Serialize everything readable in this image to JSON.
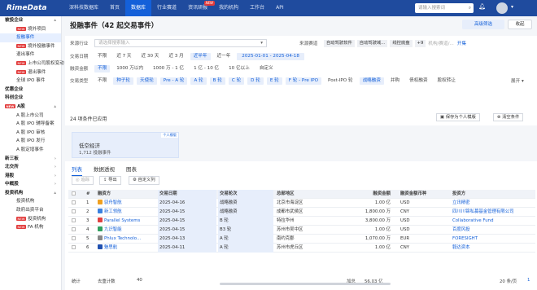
{
  "app": {
    "logo": "RimeData"
  },
  "nav": [
    "深科技数据库",
    "首页",
    "数据库",
    "行业赛道",
    "资讯研报",
    "我的机构",
    "工作台",
    "API"
  ],
  "nav_new_badge": "NEW",
  "search_placeholder": "请输入搜索词",
  "sidebar": {
    "items": [
      {
        "label": "被投企业",
        "type": "group"
      },
      {
        "label": "境外项目",
        "type": "sub",
        "tag": "NEW"
      },
      {
        "label": "投融事件",
        "type": "sub",
        "active": true
      },
      {
        "label": "境外投融事件",
        "type": "sub",
        "tag": "NEW"
      },
      {
        "label": "退出事件",
        "type": "sub"
      },
      {
        "label": "上市公司股权变动",
        "type": "sub",
        "tag": "NEW"
      },
      {
        "label": "退出事件",
        "type": "sub",
        "tag": "NEW"
      },
      {
        "label": "全球 IPO 事件",
        "type": "sub"
      },
      {
        "label": "优惠企业",
        "type": "group"
      },
      {
        "label": "科创企业",
        "type": "group"
      },
      {
        "label": "A股",
        "type": "group",
        "tag": "NEW"
      },
      {
        "label": "A 股上市公司",
        "type": "sub"
      },
      {
        "label": "A 股 IPO 辅导备案",
        "type": "sub"
      },
      {
        "label": "A 股 IPO 审核",
        "type": "sub"
      },
      {
        "label": "A 股 IPO 发行",
        "type": "sub"
      },
      {
        "label": "A 股定增事件",
        "type": "sub"
      },
      {
        "label": "新三板",
        "type": "group"
      },
      {
        "label": "北交所",
        "type": "group"
      },
      {
        "label": "港股",
        "type": "group"
      },
      {
        "label": "中概股",
        "type": "group"
      },
      {
        "label": "投资机构",
        "type": "group"
      },
      {
        "label": "投资机构",
        "type": "sub"
      },
      {
        "label": "政府出资平台",
        "type": "sub"
      },
      {
        "label": "投资机构",
        "type": "sub",
        "tag": "NEW"
      },
      {
        "label": "FA 机构",
        "type": "sub",
        "tag": "NEW"
      }
    ]
  },
  "header": {
    "title": "投融事件（42 起交易事件）",
    "advanced_btn": "高级筛选",
    "collapse_btn": "收起"
  },
  "filters": {
    "company_label": "来源行业",
    "company_placeholder": "请选择搜索输入",
    "industry_label": "来源赛道",
    "industry_tags": [
      "自动驾驶软件",
      "自动驾驶域...",
      "线控底盘"
    ],
    "industry_more": "+9",
    "industry_extra": "机构/赛道/...",
    "industry_toggle": "开集",
    "date_label": "交易日期",
    "date_chips": [
      "不限",
      "近 7 天",
      "近 30 天",
      "近 3 月",
      "近半年",
      "近一年"
    ],
    "date_range": "2025-01-01 - 2025-04-18",
    "amount_label": "融资金额",
    "amount_chips": [
      "不限",
      "1000 万以内",
      "1000 万 - 1 亿",
      "1 亿 - 10 亿",
      "10 亿以上",
      "自定义"
    ],
    "type_label": "交易类型",
    "type_chips": [
      "不限",
      "种子轮",
      "天使轮",
      "Pre - A 轮",
      "A 轮",
      "B 轮",
      "C 轮",
      "D 轮",
      "E 轮",
      "F 轮 - Pre IPO",
      "Post-IPO 轮",
      "战略融资",
      "并购",
      "债权融资",
      "股权转让"
    ],
    "type_expand": "展开",
    "applied": "24 项条件已应用",
    "save_template": "保存为个人模版",
    "clear": "清空条件"
  },
  "card": {
    "tag": "个人模版",
    "name": "低空经济",
    "count": "1,712 投融事件"
  },
  "tabs": [
    "列表",
    "数据透视",
    "图表"
  ],
  "toolbar": {
    "filter": "追踪",
    "export": "导出",
    "custom_cols": "自定义列"
  },
  "table": {
    "headers": [
      "#",
      "融资方",
      "交易日期",
      "交易轮次",
      "总部地区",
      "融资金额",
      "融资金额币种",
      "投资方"
    ],
    "rows": [
      {
        "n": "1",
        "company": "驭舟智航",
        "date": "2025-04-16",
        "round": "战略融资",
        "region": "北京市海淀区",
        "amount": "1.00 亿",
        "currency": "USD",
        "investor": "立讯精密",
        "color": "#f0a020"
      },
      {
        "n": "2",
        "company": "新工领航",
        "date": "2025-04-15",
        "round": "战略融资",
        "region": "成都市武侯区",
        "amount": "1,800.00 万",
        "currency": "CNY",
        "investor": "四川川锦私募基金管理有限公司",
        "color": "#3a80e0"
      },
      {
        "n": "3",
        "company": "Parallel Systems",
        "date": "2025-04-15",
        "round": "B 轮",
        "region": "特拉华州",
        "amount": "3,800.00 万",
        "currency": "USD",
        "investor": "Collaborative Fund",
        "color": "#e04040"
      },
      {
        "n": "4",
        "company": "九识智能",
        "date": "2025-04-15",
        "round": "B3 轮",
        "region": "苏州市吴中区",
        "amount": "1.00 亿",
        "currency": "USD",
        "investor": "百度风投",
        "color": "#30a060"
      },
      {
        "n": "5",
        "company": "Phlux Technolo...",
        "date": "2025-04-13",
        "round": "A 轮",
        "region": "南约克郡",
        "amount": "1,070.00 万",
        "currency": "EUR",
        "investor": "FORESIGHT",
        "color": "#888888"
      },
      {
        "n": "6",
        "company": "魅思航",
        "date": "2025-04-11",
        "round": "A 轮",
        "region": "苏州市虎丘区",
        "amount": "1.00 亿",
        "currency": "CNY",
        "investor": "毅达资本",
        "color": "#2050b0"
      }
    ],
    "footer": {
      "stat": "统计",
      "dedup": "去重计数",
      "dedup_val": "40",
      "sum": "加总",
      "sum_val": "56.03 亿",
      "page_size": "20 条/页",
      "page": "1"
    }
  }
}
